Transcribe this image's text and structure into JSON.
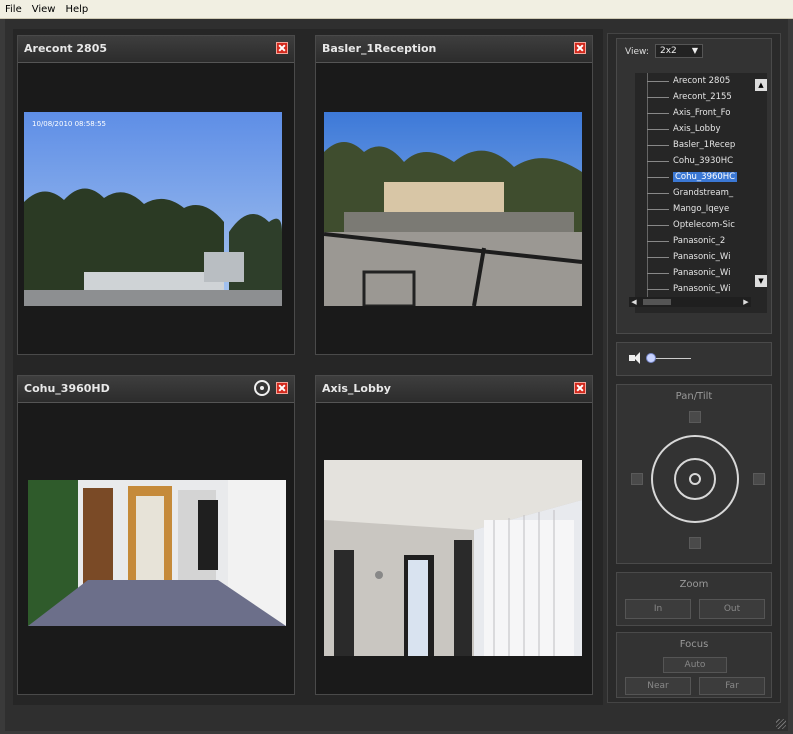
{
  "menu": [
    "File",
    "View",
    "Help"
  ],
  "panels": [
    {
      "title": "Arecont 2805"
    },
    {
      "title": "Basler_1Reception"
    },
    {
      "title": "Cohu_3960HD"
    },
    {
      "title": "Axis_Lobby"
    }
  ],
  "overlay_text": "10/08/2010  08:58:55",
  "sidebar": {
    "view_label": "View:",
    "view_value": "2x2",
    "cameras": [
      "Arecont 2805",
      "Arecont_2155",
      "Axis_Front_Fo",
      "Axis_Lobby",
      "Basler_1Recep",
      "Cohu_3930HC",
      "Cohu_3960HC",
      "Grandstream_",
      "Mango_Iqeye",
      "Optelecom-Sic",
      "Panasonic_2",
      "Panasonic_Wi",
      "Panasonic_Wi",
      "Panasonic_Wi"
    ],
    "selected_camera_index": 6,
    "volume_level": 0.1,
    "ptz_title": "Pan/Tilt",
    "zoom_title": "Zoom",
    "zoom_in": "In",
    "zoom_out": "Out",
    "focus_title": "Focus",
    "focus_auto": "Auto",
    "focus_near": "Near",
    "focus_far": "Far"
  }
}
